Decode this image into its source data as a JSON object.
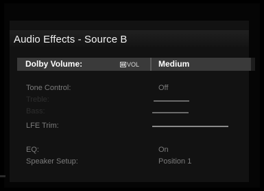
{
  "menu": {
    "title": "Audio Effects - Source B",
    "selected": {
      "label": "Dolby Volume:",
      "badge": "VOL",
      "value": "Medium"
    },
    "items": [
      {
        "label": "Tone Control:",
        "value": "Off"
      },
      {
        "label": "Treble:",
        "value": ""
      },
      {
        "label": "Bass:",
        "value": ""
      },
      {
        "label": "LFE Trim:",
        "value": ""
      },
      {
        "label": "EQ:",
        "value": "On"
      },
      {
        "label": "Speaker Setup:",
        "value": "Position 1"
      }
    ]
  }
}
